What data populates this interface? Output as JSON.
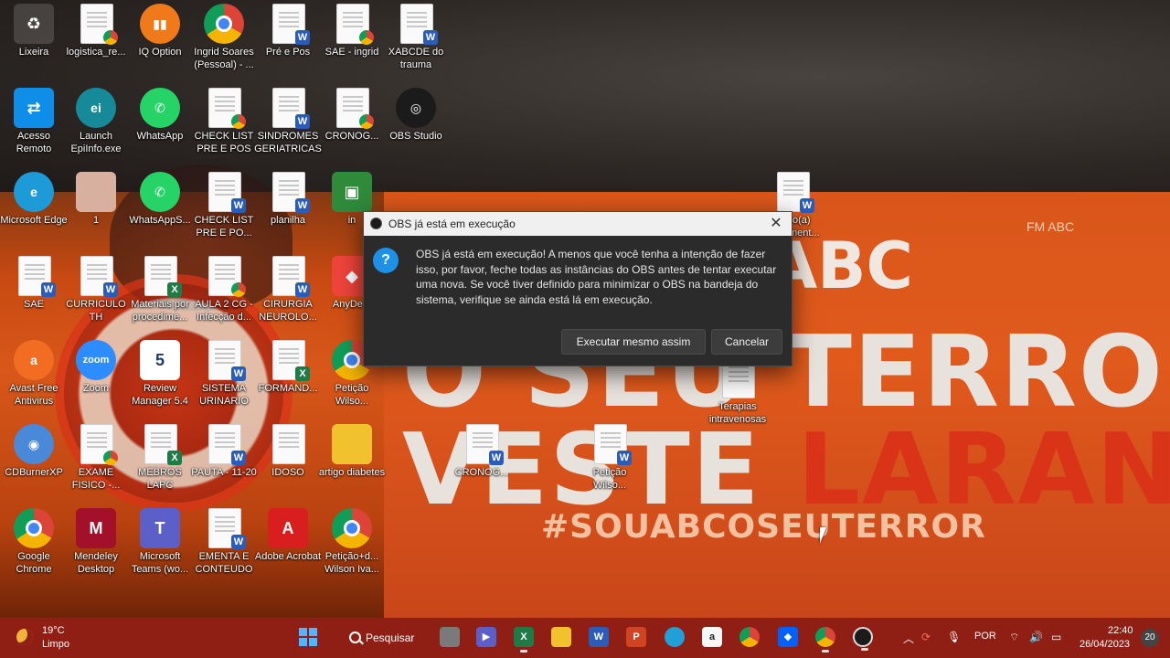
{
  "desktop": {
    "icons": [
      {
        "label": "Lixeira",
        "icon": "recycle-bin"
      },
      {
        "label": "logistica_re...",
        "icon": "chrome-doc"
      },
      {
        "label": "IQ Option",
        "icon": "iq-option"
      },
      {
        "label": "Ingrid Soares (Pessoal) - ...",
        "icon": "chrome-profile"
      },
      {
        "label": "Pré e Pos",
        "icon": "word-doc"
      },
      {
        "label": "SAE - ingrid",
        "icon": "chrome-doc"
      },
      {
        "label": "XABCDE do trauma",
        "icon": "word-doc"
      },
      {
        "label": "Acesso Remoto",
        "icon": "teamviewer"
      },
      {
        "label": "Launch EpiInfo.exe",
        "icon": "epiinfo"
      },
      {
        "label": "WhatsApp",
        "icon": "whatsapp"
      },
      {
        "label": "CHECK LIST PRE E POS",
        "icon": "chrome-doc"
      },
      {
        "label": "SINDROMES GERIATRICAS",
        "icon": "word-doc"
      },
      {
        "label": "CRONOG...",
        "icon": "chrome-doc"
      },
      {
        "label": "OBS Studio",
        "icon": "obs"
      },
      {
        "label": "Microsoft Edge",
        "icon": "edge"
      },
      {
        "label": "1",
        "icon": "photo"
      },
      {
        "label": "WhatsAppS...",
        "icon": "whatsapp"
      },
      {
        "label": "CHECK LIST PRE E PO...",
        "icon": "word-doc"
      },
      {
        "label": "planilha",
        "icon": "word-doc"
      },
      {
        "label": "in",
        "icon": "image"
      },
      {
        "label": "SAE",
        "icon": "word-doc"
      },
      {
        "label": "CURRICULO TH",
        "icon": "word-doc"
      },
      {
        "label": "Materiais por procedime...",
        "icon": "excel-doc"
      },
      {
        "label": "AULA 2 CG - Infecção d...",
        "icon": "chrome-doc"
      },
      {
        "label": "CIRURGIA NEUROLO...",
        "icon": "word-doc"
      },
      {
        "label": "AnyDe...",
        "icon": "anydesk"
      },
      {
        "label": "Avast Free Antivirus",
        "icon": "avast"
      },
      {
        "label": "Zoom",
        "icon": "zoom"
      },
      {
        "label": "Review Manager 5.4",
        "icon": "revman"
      },
      {
        "label": "SISTEMA URINARIO",
        "icon": "word-doc"
      },
      {
        "label": "FORMAND...",
        "icon": "excel-doc"
      },
      {
        "label": "Petição Wilso...",
        "icon": "chrome"
      },
      {
        "label": "CDBurnerXP",
        "icon": "cdburner"
      },
      {
        "label": "EXAME FISICO -...",
        "icon": "chrome-doc"
      },
      {
        "label": "MEBROS LAPC",
        "icon": "excel-doc"
      },
      {
        "label": "PAUTA - 11-20",
        "icon": "word-doc"
      },
      {
        "label": "IDOSO",
        "icon": "doc"
      },
      {
        "label": "artigo diabetes",
        "icon": "folder"
      },
      {
        "label": "Google Chrome",
        "icon": "chrome"
      },
      {
        "label": "Mendeley Desktop",
        "icon": "mendeley"
      },
      {
        "label": "Microsoft Teams (wo...",
        "icon": "teams"
      },
      {
        "label": "EMENTA E CONTEUDO",
        "icon": "word-doc"
      },
      {
        "label": "Adobe Acrobat",
        "icon": "acrobat"
      },
      {
        "label": "Petição+d... Wilson Iva...",
        "icon": "chrome"
      },
      {
        "label": "Terapias intravenosas",
        "icon": "doc"
      },
      {
        "label": "CRONOG...",
        "icon": "word-doc"
      },
      {
        "label": "Petição Wilso...",
        "icon": "word-doc"
      },
      {
        "label": "Novo(a) Document...",
        "icon": "word-doc"
      }
    ]
  },
  "wallpaper": {
    "line1_a": "O SEU ",
    "line1_b": "TERROR",
    "line2_a": "VESTE ",
    "line2_b": "LARANJA",
    "abc": "ABC",
    "hashtag": "#SOUABCOSEUTERROR",
    "fmabc": "FM ABC"
  },
  "dialog": {
    "title": "OBS já está em execução",
    "message": "OBS já está em execução! A menos que você tenha a intenção de fazer isso, por favor, feche todas as instâncias do OBS antes de tentar executar uma nova. Se você tiver definido para minimizar o OBS na bandeja do sistema, verifique se ainda está lá em execução.",
    "run_anyway": "Executar mesmo assim",
    "cancel": "Cancelar",
    "close": "✕"
  },
  "taskbar": {
    "weather_temp": "19°C",
    "weather_cond": "Limpo",
    "search_label": "Pesquisar",
    "language": "POR",
    "time": "22:40",
    "date": "26/04/2023",
    "notifications": "20",
    "apps": [
      "task-view",
      "teams-meet",
      "excel",
      "file-explorer",
      "word",
      "powerpoint",
      "edge",
      "amazon",
      "chrome",
      "dropbox",
      "chrome-profile",
      "obs"
    ]
  },
  "colors": {
    "taskbar": "#8f1f14",
    "dialog_bg": "#2b2b2b",
    "accent_orange": "#d9571a",
    "wallpaper_red": "#d93418"
  }
}
